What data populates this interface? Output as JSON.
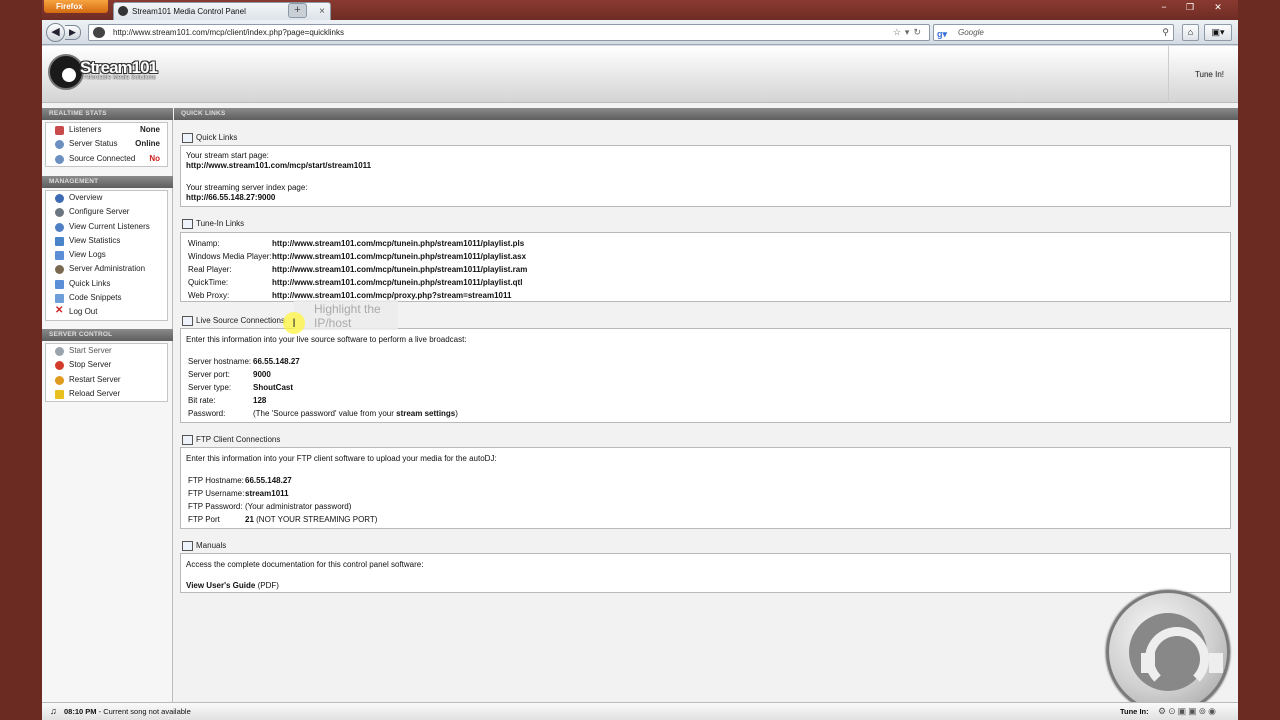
{
  "browser": {
    "menu_button": "Firefox",
    "tab_title": "Stream101 Media Control Panel",
    "url": "http://www.stream101.com/mcp/client/index.php?page=quicklinks",
    "search_engine": "Google",
    "search_placeholder": "Google"
  },
  "header": {
    "logo_name": "Stream101",
    "logo_tagline": "Affordable Media Solutions",
    "tune_in": "Tune In!"
  },
  "sidebar": {
    "realtime_title": "REALTIME STATS",
    "stats": [
      {
        "label": "Listeners",
        "value": "None",
        "color": "#d03030"
      },
      {
        "label": "Server Status",
        "value": "Online",
        "color": "#3a8a3a"
      },
      {
        "label": "Source Connected",
        "value": "No",
        "color": "#cc2222"
      }
    ],
    "management_title": "MANAGEMENT",
    "management": [
      {
        "label": "Overview",
        "icon": "info-icon"
      },
      {
        "label": "Configure Server",
        "icon": "gear-icon"
      },
      {
        "label": "View Current Listeners",
        "icon": "users-icon"
      },
      {
        "label": "View Statistics",
        "icon": "chart-icon"
      },
      {
        "label": "View Logs",
        "icon": "log-icon"
      },
      {
        "label": "Server Administration",
        "icon": "admin-icon"
      },
      {
        "label": "Quick Links",
        "icon": "link-icon"
      },
      {
        "label": "Code Snippets",
        "icon": "code-icon"
      },
      {
        "label": "Log Out",
        "icon": "logout-icon"
      }
    ],
    "server_control_title": "SERVER CONTROL",
    "server_control": [
      {
        "label": "Start Server",
        "icon": "start-icon"
      },
      {
        "label": "Stop Server",
        "icon": "stop-icon"
      },
      {
        "label": "Restart Server",
        "icon": "restart-icon"
      },
      {
        "label": "Reload Server",
        "icon": "reload-icon"
      }
    ]
  },
  "main": {
    "section_title": "QUICK LINKS",
    "quick_links": {
      "title": "Quick Links",
      "start_label": "Your stream start page:",
      "start_url": "http://www.stream101.com/mcp/start/stream1011",
      "index_label": "Your streaming server index page:",
      "index_url": "http://66.55.148.27:9000"
    },
    "tunein": {
      "title": "Tune-In Links",
      "rows": [
        {
          "label": "Winamp:",
          "url": "http://www.stream101.com/mcp/tunein.php/stream1011/playlist.pls"
        },
        {
          "label": "Windows Media Player:",
          "url": "http://www.stream101.com/mcp/tunein.php/stream1011/playlist.asx"
        },
        {
          "label": "Real Player:",
          "url": "http://www.stream101.com/mcp/tunein.php/stream1011/playlist.ram"
        },
        {
          "label": "QuickTime:",
          "url": "http://www.stream101.com/mcp/tunein.php/stream1011/playlist.qtl"
        },
        {
          "label": "Web Proxy:",
          "url": "http://www.stream101.com/mcp/proxy.php?stream=stream1011"
        }
      ]
    },
    "live_source": {
      "title": "Live Source Connections",
      "intro": "Enter this information into your live source software to perform a live broadcast:",
      "hostname_label": "Server hostname:",
      "hostname": "66.55.148.27",
      "port_label": "Server port:",
      "port": "9000",
      "type_label": "Server type:",
      "type": "ShoutCast",
      "bitrate_label": "Bit rate:",
      "bitrate": "128",
      "password_label": "Password:",
      "password_pre": "(The 'Source password' value from your ",
      "password_link": "stream settings",
      "password_post": ")"
    },
    "ftp": {
      "title": "FTP Client Connections",
      "intro": "Enter this information into your FTP client software to upload your media for the autoDJ:",
      "host_label": "FTP Hostname:",
      "host": "66.55.148.27",
      "user_label": "FTP Username:",
      "user": "stream1011",
      "pass_label": "FTP Password:",
      "pass": "(Your administrator password)",
      "port_label": "FTP Port",
      "port": "21",
      "port_note": " (NOT YOUR STREAMING PORT)"
    },
    "manuals": {
      "title": "Manuals",
      "intro": "Access the complete documentation for this control panel software:",
      "guide": "View User's Guide",
      "guide_note": " (PDF)"
    }
  },
  "annotation": {
    "line1": "Highlight the",
    "line2": "IP/host"
  },
  "footer": {
    "time": "08:10 PM",
    "song": " - Current song not available",
    "tune_in": "Tune In:"
  }
}
